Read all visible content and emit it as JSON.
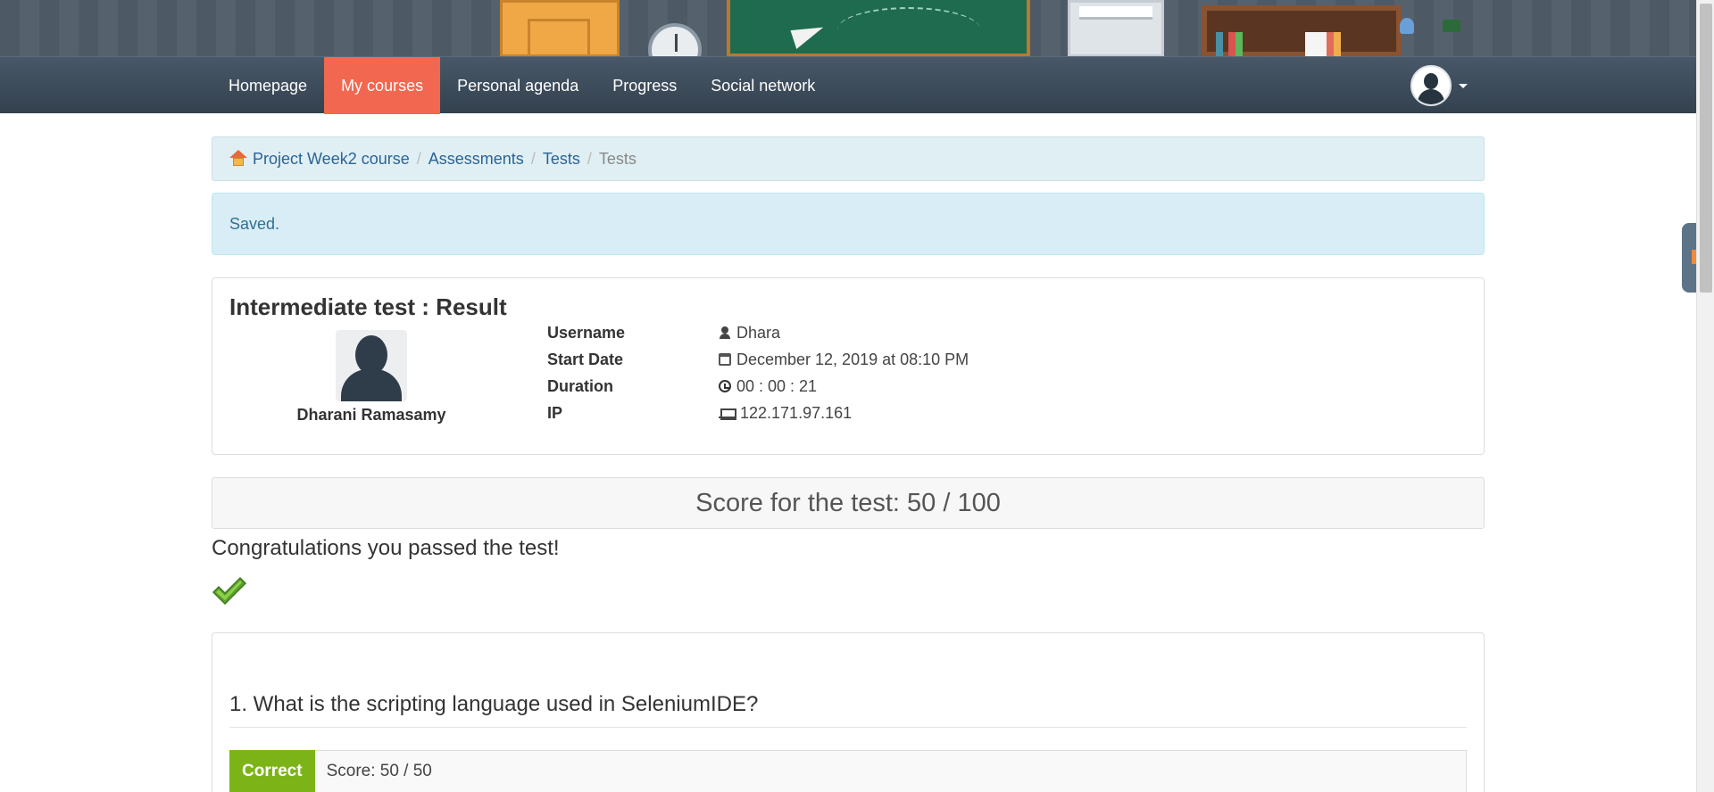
{
  "nav": {
    "items": [
      {
        "label": "Homepage",
        "active": false
      },
      {
        "label": "My courses",
        "active": true
      },
      {
        "label": "Personal agenda",
        "active": false
      },
      {
        "label": "Progress",
        "active": false
      },
      {
        "label": "Social network",
        "active": false
      }
    ],
    "accent_color": "#f2674f"
  },
  "breadcrumb": {
    "items": [
      "Project Week2 course",
      "Assessments",
      "Tests"
    ],
    "current": "Tests"
  },
  "alert": {
    "message": "Saved."
  },
  "result": {
    "title": "Intermediate test : Result",
    "full_name": "Dharani Ramasamy",
    "fields": [
      {
        "label": "Username",
        "value": "Dhara",
        "icon": "user-icon"
      },
      {
        "label": "Start Date",
        "value": "December 12, 2019 at 08:10 PM",
        "icon": "calendar-icon"
      },
      {
        "label": "Duration",
        "value": "00 : 00 : 21",
        "icon": "clock-icon"
      },
      {
        "label": "IP",
        "value": "122.171.97.161",
        "icon": "laptop-icon"
      }
    ]
  },
  "score": {
    "text": "Score for the test: 50 / 100"
  },
  "congrats": {
    "text": "Congratulations you passed the test!"
  },
  "question": {
    "title": "1. What is the scripting language used in SeleniumIDE?",
    "status": "Correct",
    "score_text": "Score: 50 / 50",
    "status_color": "#7cb418"
  }
}
